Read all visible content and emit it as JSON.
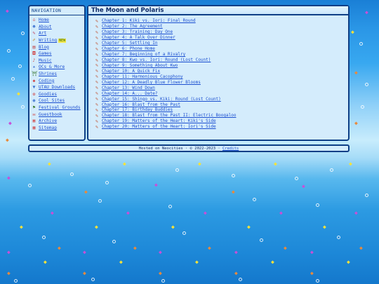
{
  "nav": {
    "heading": "NAVIGATION",
    "items": [
      {
        "label": "Home",
        "icon": "house-icon",
        "glyph": "⌂",
        "color": "#d04848"
      },
      {
        "label": "About",
        "icon": "person-icon",
        "glyph": "☻",
        "color": "#3a70d0"
      },
      {
        "label": "Art",
        "icon": "palette-icon",
        "glyph": "✎",
        "color": "#c0304a"
      },
      {
        "label": "Writing",
        "icon": "pencil-icon",
        "glyph": "✐",
        "color": "#c08020",
        "tag": "NEW"
      },
      {
        "label": "Blog",
        "icon": "book-icon",
        "glyph": "▤",
        "color": "#c04040"
      },
      {
        "label": "Games",
        "icon": "gamepad-icon",
        "glyph": "◘",
        "color": "#d04848"
      },
      {
        "label": "Music",
        "icon": "music-note-icon",
        "glyph": "♪",
        "color": "#d04848"
      },
      {
        "label": "OCs & More",
        "icon": "star-icon",
        "glyph": "★",
        "color": "#3a70d0"
      },
      {
        "label": "Shrines",
        "icon": "shrine-icon",
        "glyph": "⛩",
        "color": "#3a7a30"
      },
      {
        "label": "Coding",
        "icon": "code-icon",
        "glyph": "◆",
        "color": "#d04848"
      },
      {
        "label": "UTAU Downloads",
        "icon": "download-icon",
        "glyph": "▼",
        "color": "#3a70d0"
      },
      {
        "label": "Goodies",
        "icon": "gift-icon",
        "glyph": "✿",
        "color": "#d04848"
      },
      {
        "label": "Cool Sites",
        "icon": "globe-icon",
        "glyph": "◉",
        "color": "#3a70d0"
      },
      {
        "label": "Festival Grounds",
        "icon": "flag-icon",
        "glyph": "⚑",
        "color": "#3a7a30"
      },
      {
        "label": "Guestbook",
        "icon": "guestbook-icon",
        "glyph": "✉",
        "color": "#d04848"
      },
      {
        "label": "Archive",
        "icon": "archive-icon",
        "glyph": "▣",
        "color": "#d04848"
      },
      {
        "label": "Sitemap",
        "icon": "map-icon",
        "glyph": "▦",
        "color": "#d04848"
      }
    ]
  },
  "main": {
    "title": "The Moon and Polaris",
    "chapters": [
      "Chapter 1: Kiki vs. Iori: Final Round",
      "Chapter 2: The Agreement",
      "Chapter 3: Training: Day One",
      "Chapter 4: A Talk Over Dinner",
      "Chapter 5: Settling In",
      "Chapter 6: Phone Home",
      "Chapter 7: Beginning of a Rivalry",
      "Chapter 8: Kwo vs. Iori: Round (Lost Count)",
      "Chapter 9: Something About Kwo",
      "Chapter 10: A Quick Fix",
      "Chapter 11: Harmonious Cacophony",
      "Chapter 12: A Deadly Blue Flower Blooms",
      "Chapter 13: Wind Down",
      "Chapter 14: A... Date?",
      "Chapter 15: Shingo vs. Kiki: Round (Lost Count)",
      "Chapter 16: Blast from the Past",
      "Chapter 17: Birthday Buddies",
      "Chapter 18: Blast from the Past II: Electric Boogaloo",
      "Chapter 19: Matters of the Heart: Kiki's Side",
      "Chapter 20: Matters of the Heart: Iori's Side"
    ]
  },
  "footer": {
    "text": "Hosted on Neocities · © 2022-2023 · ",
    "link": "Credits"
  },
  "colors": {
    "border": "#0e3f86",
    "panel": "#d4ecfc",
    "link": "#1b4fd0",
    "new_tag": "#f5e84a"
  }
}
